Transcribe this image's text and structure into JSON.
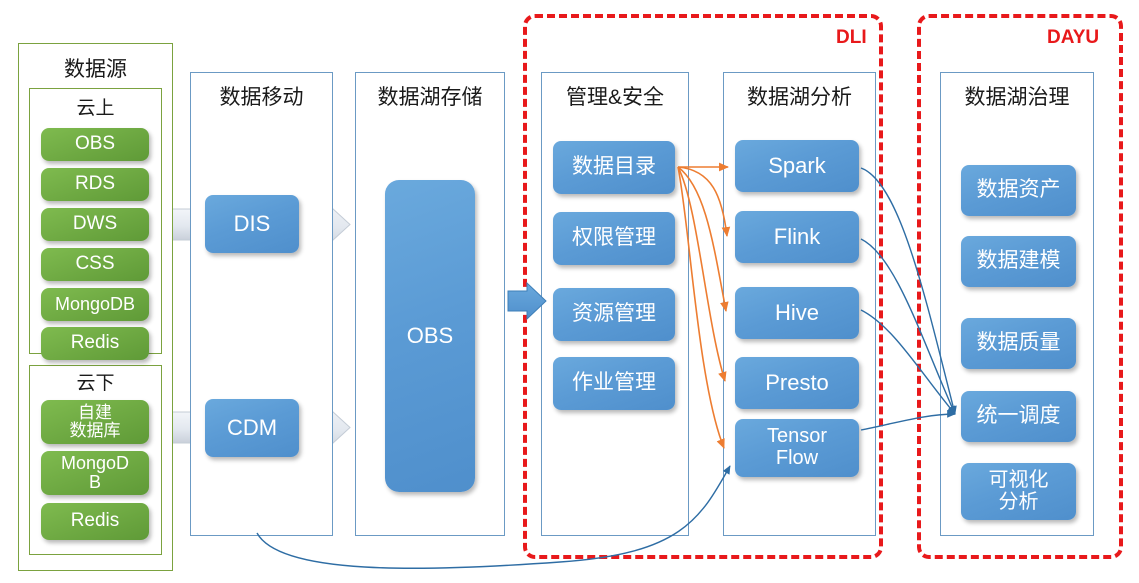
{
  "regions": [
    {
      "name": "DLI",
      "label": "DLI"
    },
    {
      "name": "DAYU",
      "label": "DAYU"
    }
  ],
  "columns": {
    "data_source": {
      "title": "数据源",
      "groups": [
        {
          "title": "云上",
          "items": [
            "OBS",
            "RDS",
            "DWS",
            "CSS",
            "MongoDB",
            "Redis"
          ]
        },
        {
          "title": "云下",
          "items": [
            "自建\n数据库",
            "MongoD\nB",
            "Redis"
          ]
        }
      ]
    },
    "data_movement": {
      "title": "数据移动",
      "items": [
        "DIS",
        "CDM"
      ]
    },
    "lake_storage": {
      "title": "数据湖存储",
      "items": [
        "OBS"
      ]
    },
    "management_security": {
      "title": "管理&安全",
      "items": [
        "数据目录",
        "权限管理",
        "资源管理",
        "作业管理"
      ]
    },
    "lake_analysis": {
      "title": "数据湖分析",
      "items": [
        "Spark",
        "Flink",
        "Hive",
        "Presto",
        "Tensor\nFlow"
      ]
    },
    "lake_governance": {
      "title": "数据湖治理",
      "items": [
        "数据资产",
        "数据建模",
        "数据质量",
        "统一调度",
        "可视化\n分析"
      ]
    }
  },
  "colors": {
    "blue_node": "#5b9bd5",
    "green_node": "#6faa43",
    "red_dashed": "#e8191b",
    "panel_blue_border": "#6b9ac4",
    "panel_green_border": "#7ba23f",
    "orange_connector": "#ed7d31",
    "blue_connector": "#2e6da4",
    "gray_arrow": "#dde2ea"
  },
  "connectors": {
    "gray_arrows": [
      "data-source-to-DIS",
      "DIS-to-OBS",
      "data-source-to-CDM",
      "CDM-to-OBS"
    ],
    "blue_small_arrow": "OBS-to-management",
    "orange_fan": "数据目录 → Spark / Flink / Hive / Presto / TensorFlow",
    "blue_fan": "Spark / Flink / Hive / TensorFlow → 统一调度",
    "bottom_curve": "数据源 → Tensor Flow"
  }
}
